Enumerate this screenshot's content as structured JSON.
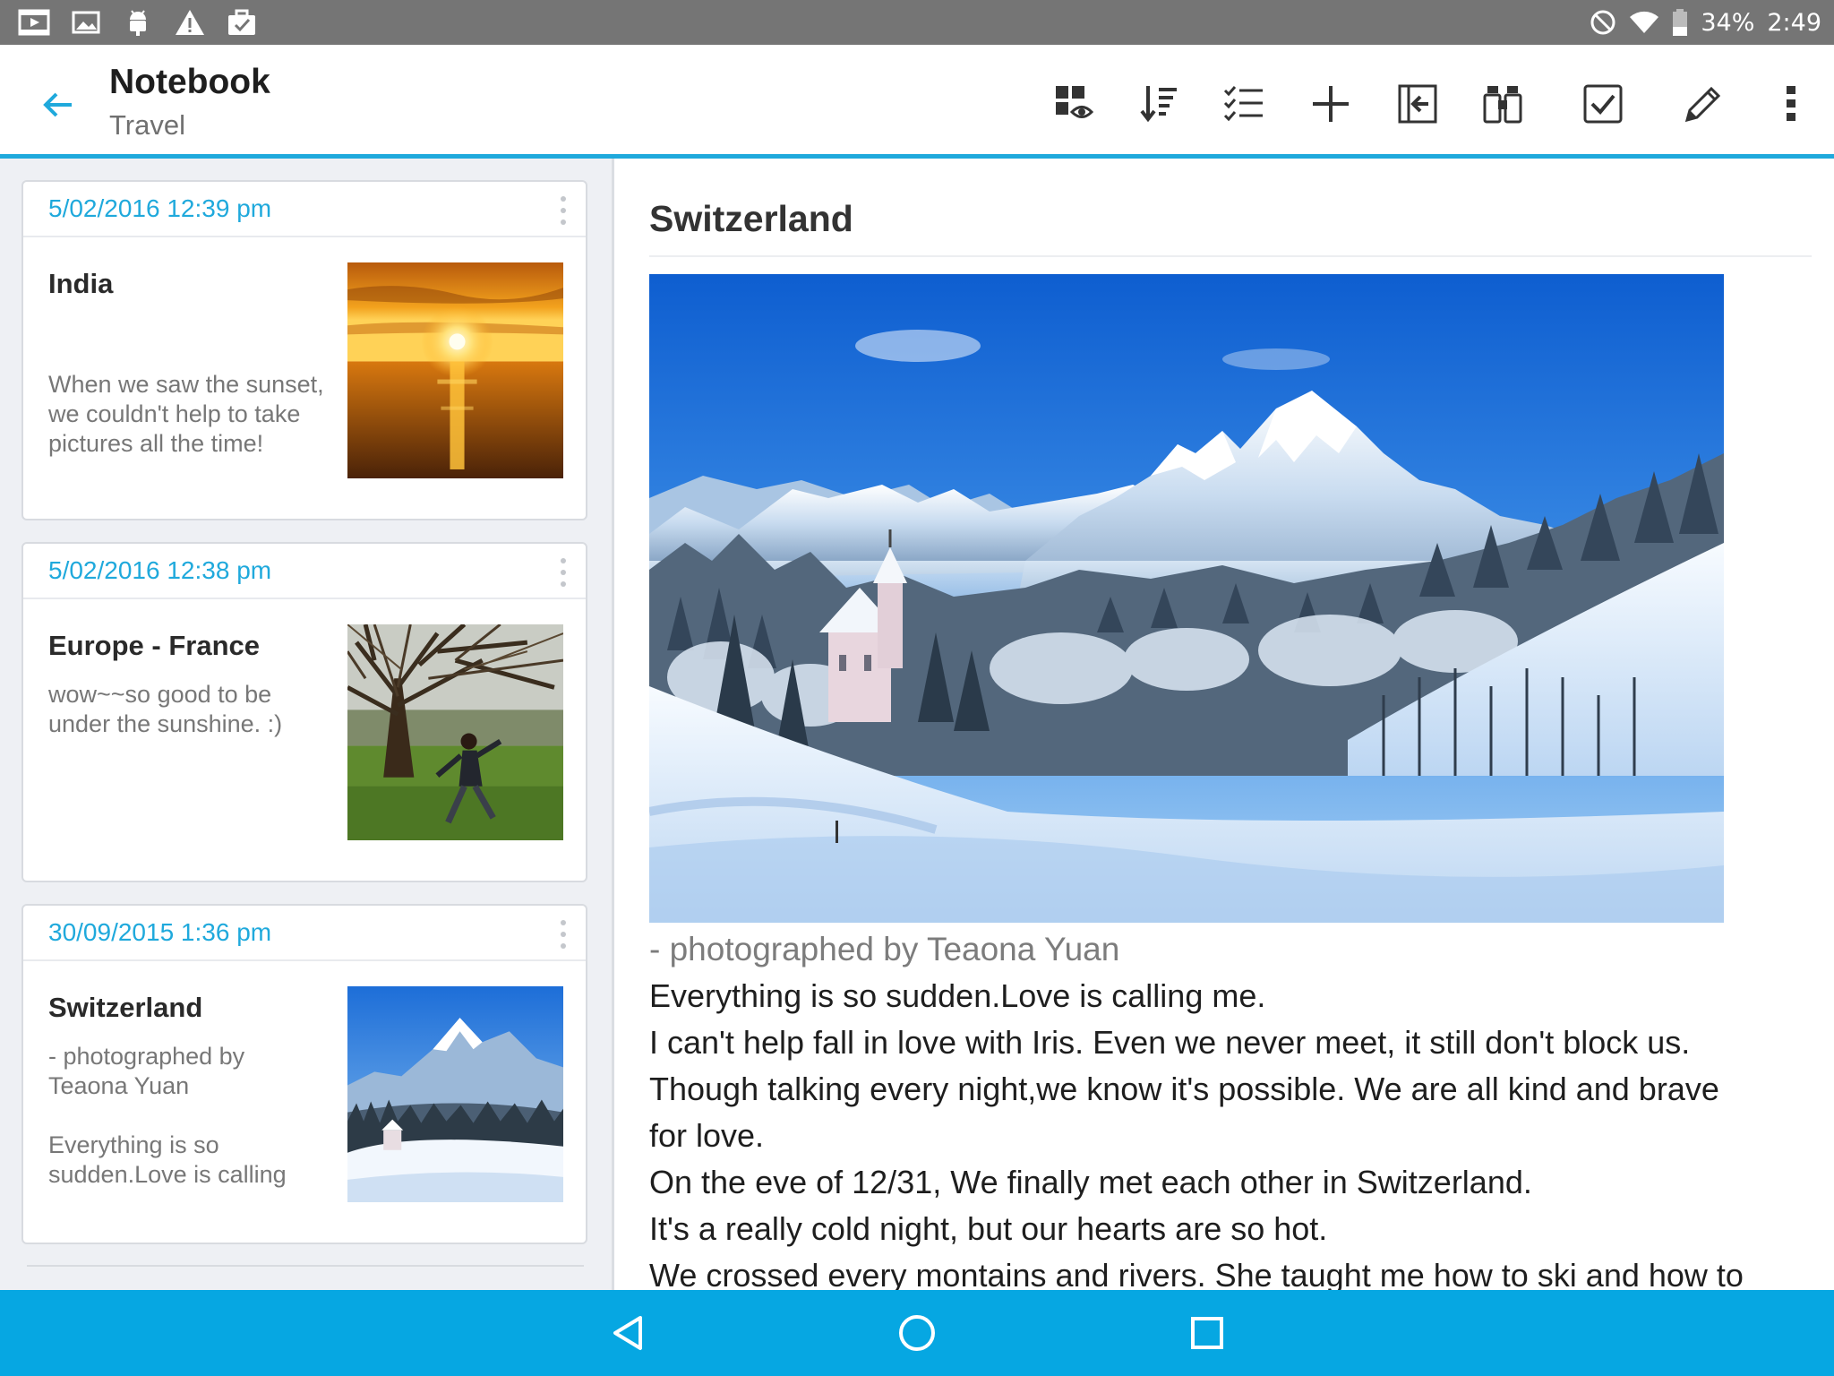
{
  "status_bar": {
    "battery": "34%",
    "time": "2:49"
  },
  "app_bar": {
    "title": "Notebook",
    "subtitle": "Travel"
  },
  "accent_color": "#1fa9dc",
  "nav_bar_color": "#06a7e2",
  "notes": [
    {
      "date": "5/02/2016 12:39 pm",
      "title": "India",
      "text_lines": [
        "When we saw the sunset,",
        "we couldn't help to take",
        "pictures all the time!"
      ],
      "thumbnail": "sunset-photo"
    },
    {
      "date": "5/02/2016 12:38 pm",
      "title": "Europe - France",
      "text_lines": [
        "wow~~so good to be",
        "under the sunshine. :)"
      ],
      "thumbnail": "tree-park-photo"
    },
    {
      "date": "30/09/2015 1:36 pm",
      "title": "Switzerland",
      "text_lines": [
        "- photographed by",
        "Teaona Yuan",
        "",
        "Everything is so",
        "sudden.Love is calling"
      ],
      "thumbnail": "snowy-mountain-photo"
    }
  ],
  "detail": {
    "title": "Switzerland",
    "caption": "- photographed by Teaona Yuan",
    "body_lines": [
      "Everything is so sudden.Love is calling me.",
      "I can't help fall in love with Iris. Even we never meet, it still don't block us.",
      "Though talking every night,we know it's possible. We are all kind and brave",
      "for love.",
      "On the eve of 12/31, We finally met each other in Switzerland.",
      "It's a really cold night, but our hearts are so hot.",
      "We crossed every montains and rivers. She taught me how to ski and how to"
    ]
  }
}
